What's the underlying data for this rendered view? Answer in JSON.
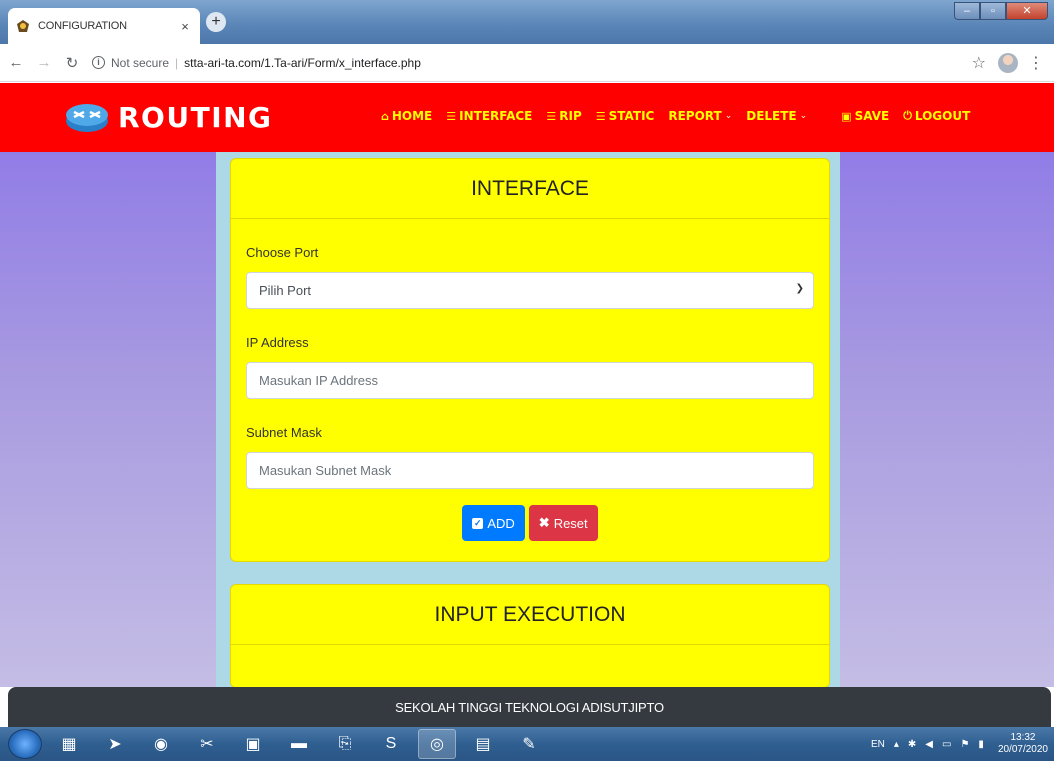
{
  "browser": {
    "tab_title": "CONFIGURATION",
    "tab_close": "×",
    "new_tab": "+",
    "security_label": "Not secure",
    "url": "stta-ari-ta.com/1.Ta-ari/Form/x_interface.php"
  },
  "navbar": {
    "brand": "ROUTING",
    "items": [
      {
        "label": "HOME",
        "icon": "home-icon",
        "glyph": "⌂"
      },
      {
        "label": "INTERFACE",
        "icon": "list-icon",
        "glyph": "☰"
      },
      {
        "label": "RIP",
        "icon": "list-icon",
        "glyph": "☰"
      },
      {
        "label": "STATIC",
        "icon": "list-icon",
        "glyph": "☰"
      },
      {
        "label": "REPORT",
        "dropdown": true
      },
      {
        "label": "DELETE",
        "dropdown": true
      },
      {
        "label": "SAVE",
        "icon": "save-icon",
        "glyph": "▣"
      },
      {
        "label": "LOGOUT",
        "icon": "power-icon",
        "glyph": "⏻"
      }
    ]
  },
  "interface_card": {
    "title": "INTERFACE",
    "port_label": "Choose Port",
    "port_selected": "Pilih Port",
    "ip_label": "IP Address",
    "ip_placeholder": "Masukan IP Address",
    "subnet_label": "Subnet Mask",
    "subnet_placeholder": "Masukan Subnet Mask",
    "add_button": "ADD",
    "reset_button": "Reset"
  },
  "execution_card": {
    "title": "INPUT EXECUTION"
  },
  "footer": {
    "text": "SEKOLAH TINGGI TEKNOLOGI ADISUTJIPTO"
  },
  "taskbar": {
    "language": "EN",
    "time": "13:32",
    "date": "20/07/2020"
  },
  "colors": {
    "navbar": "#ff0000",
    "nav_text": "#ffff00",
    "card": "#ffff00",
    "container": "#add8e6",
    "btn_primary": "#007bff",
    "btn_danger": "#dc3545",
    "footer": "#343a40"
  }
}
